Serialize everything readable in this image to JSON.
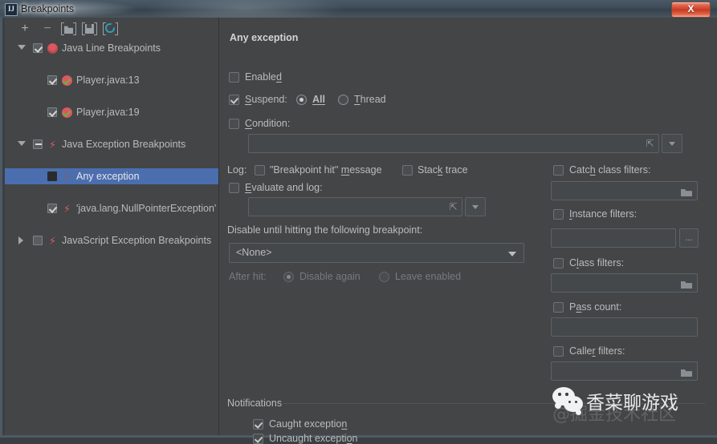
{
  "window": {
    "title": "Breakpoints",
    "icon": "intellij-idea-icon",
    "close_label": "X"
  },
  "toolbar": {
    "items": [
      {
        "name": "add-breakpoint-button",
        "icon": "plus-icon",
        "label": "+"
      },
      {
        "name": "remove-breakpoint-button",
        "icon": "minus-icon",
        "label": "−"
      },
      {
        "name": "group-by-file-button",
        "icon": "folder-bracket-icon",
        "label": ""
      },
      {
        "name": "group-by-type-button",
        "icon": "disk-bracket-icon",
        "label": ""
      },
      {
        "name": "group-by-class-button",
        "icon": "class-circle-icon",
        "label": ""
      }
    ]
  },
  "tree": {
    "nodes": [
      {
        "label": "Java Line Breakpoints",
        "expander": "down",
        "checkbox": "checked",
        "icon": "red-dot-breakpoint-icon",
        "indent": 0,
        "selected": false
      },
      {
        "label": "Player.java:13",
        "expander": "none",
        "checkbox": "checked",
        "icon": "red-dot-check-breakpoint-icon",
        "indent": 1,
        "selected": false
      },
      {
        "label": "Player.java:19",
        "expander": "none",
        "checkbox": "checked",
        "icon": "red-dot-check-breakpoint-icon",
        "indent": 1,
        "selected": false
      },
      {
        "label": "Java Exception Breakpoints",
        "expander": "down",
        "checkbox": "partial",
        "icon": "red-bolt-icon",
        "indent": 0,
        "selected": false
      },
      {
        "label": "Any exception",
        "expander": "none",
        "checkbox": "unchecked-dark",
        "icon": "dim-bolt-icon",
        "indent": 1,
        "selected": true
      },
      {
        "label": "'java.lang.NullPointerException'",
        "expander": "none",
        "checkbox": "checked",
        "icon": "red-bolt-icon",
        "indent": 1,
        "selected": false
      },
      {
        "label": "JavaScript Exception Breakpoints",
        "expander": "right",
        "checkbox": "unchecked",
        "icon": "red-bolt-icon",
        "indent": 0,
        "selected": false
      }
    ]
  },
  "details": {
    "header": "Any exception",
    "enabled": {
      "label": "Enabled",
      "checked": false
    },
    "suspend": {
      "label": "Suspend:",
      "checked": true,
      "options": [
        {
          "label": "All",
          "selected": true,
          "bold": true
        },
        {
          "label": "Thread",
          "selected": false,
          "bold": false
        }
      ]
    },
    "condition": {
      "label": "Condition:",
      "checked": false,
      "value": "",
      "expand_icon": "expand-editor-icon",
      "dropdown_icon": "chevron-down-icon"
    },
    "log": {
      "prefix": "Log:",
      "breakpoint_hit_message": {
        "label": "\"Breakpoint hit\" message",
        "checked": false
      },
      "stack_trace": {
        "label": "Stack trace",
        "checked": false
      },
      "evaluate_and_log": {
        "label": "Evaluate and log:",
        "checked": false,
        "value": ""
      }
    },
    "disable_until": {
      "label": "Disable until hitting the following breakpoint:",
      "selected_value": "<None>"
    },
    "after_hit": {
      "label": "After hit:",
      "disabled": true,
      "options": [
        {
          "label": "Disable again",
          "selected": true
        },
        {
          "label": "Leave enabled",
          "selected": false
        }
      ]
    },
    "filters": [
      {
        "id": "catch-class-filters",
        "label": "Catch class filters:",
        "checked": false,
        "value": "",
        "button": "folder-icon"
      },
      {
        "id": "instance-filters",
        "label": "Instance filters:",
        "checked": false,
        "value": "",
        "button": "ellipsis-button",
        "button_label": "..."
      },
      {
        "id": "class-filters",
        "label": "Class filters:",
        "checked": false,
        "value": "",
        "button": "folder-icon"
      },
      {
        "id": "pass-count",
        "label": "Pass count:",
        "checked": false,
        "value": "",
        "button": "none"
      },
      {
        "id": "caller-filters",
        "label": "Caller filters:",
        "checked": false,
        "value": "",
        "button": "folder-icon"
      }
    ],
    "notifications": {
      "title": "Notifications",
      "items": [
        {
          "label": "Caught exception",
          "checked": true
        },
        {
          "label": "Uncaught exception",
          "checked": true
        }
      ]
    }
  },
  "watermark": {
    "main_text": "香菜聊游戏",
    "faint_text": "@掘金技术社区",
    "icon": "wechat-logo-icon"
  },
  "colors": {
    "background": "#434547",
    "selection": "#4b6eaf",
    "breakpoint_red": "#db5860",
    "check_green": "#62b543",
    "titlebar": "#3e4b57",
    "close_red": "#c83a22"
  }
}
